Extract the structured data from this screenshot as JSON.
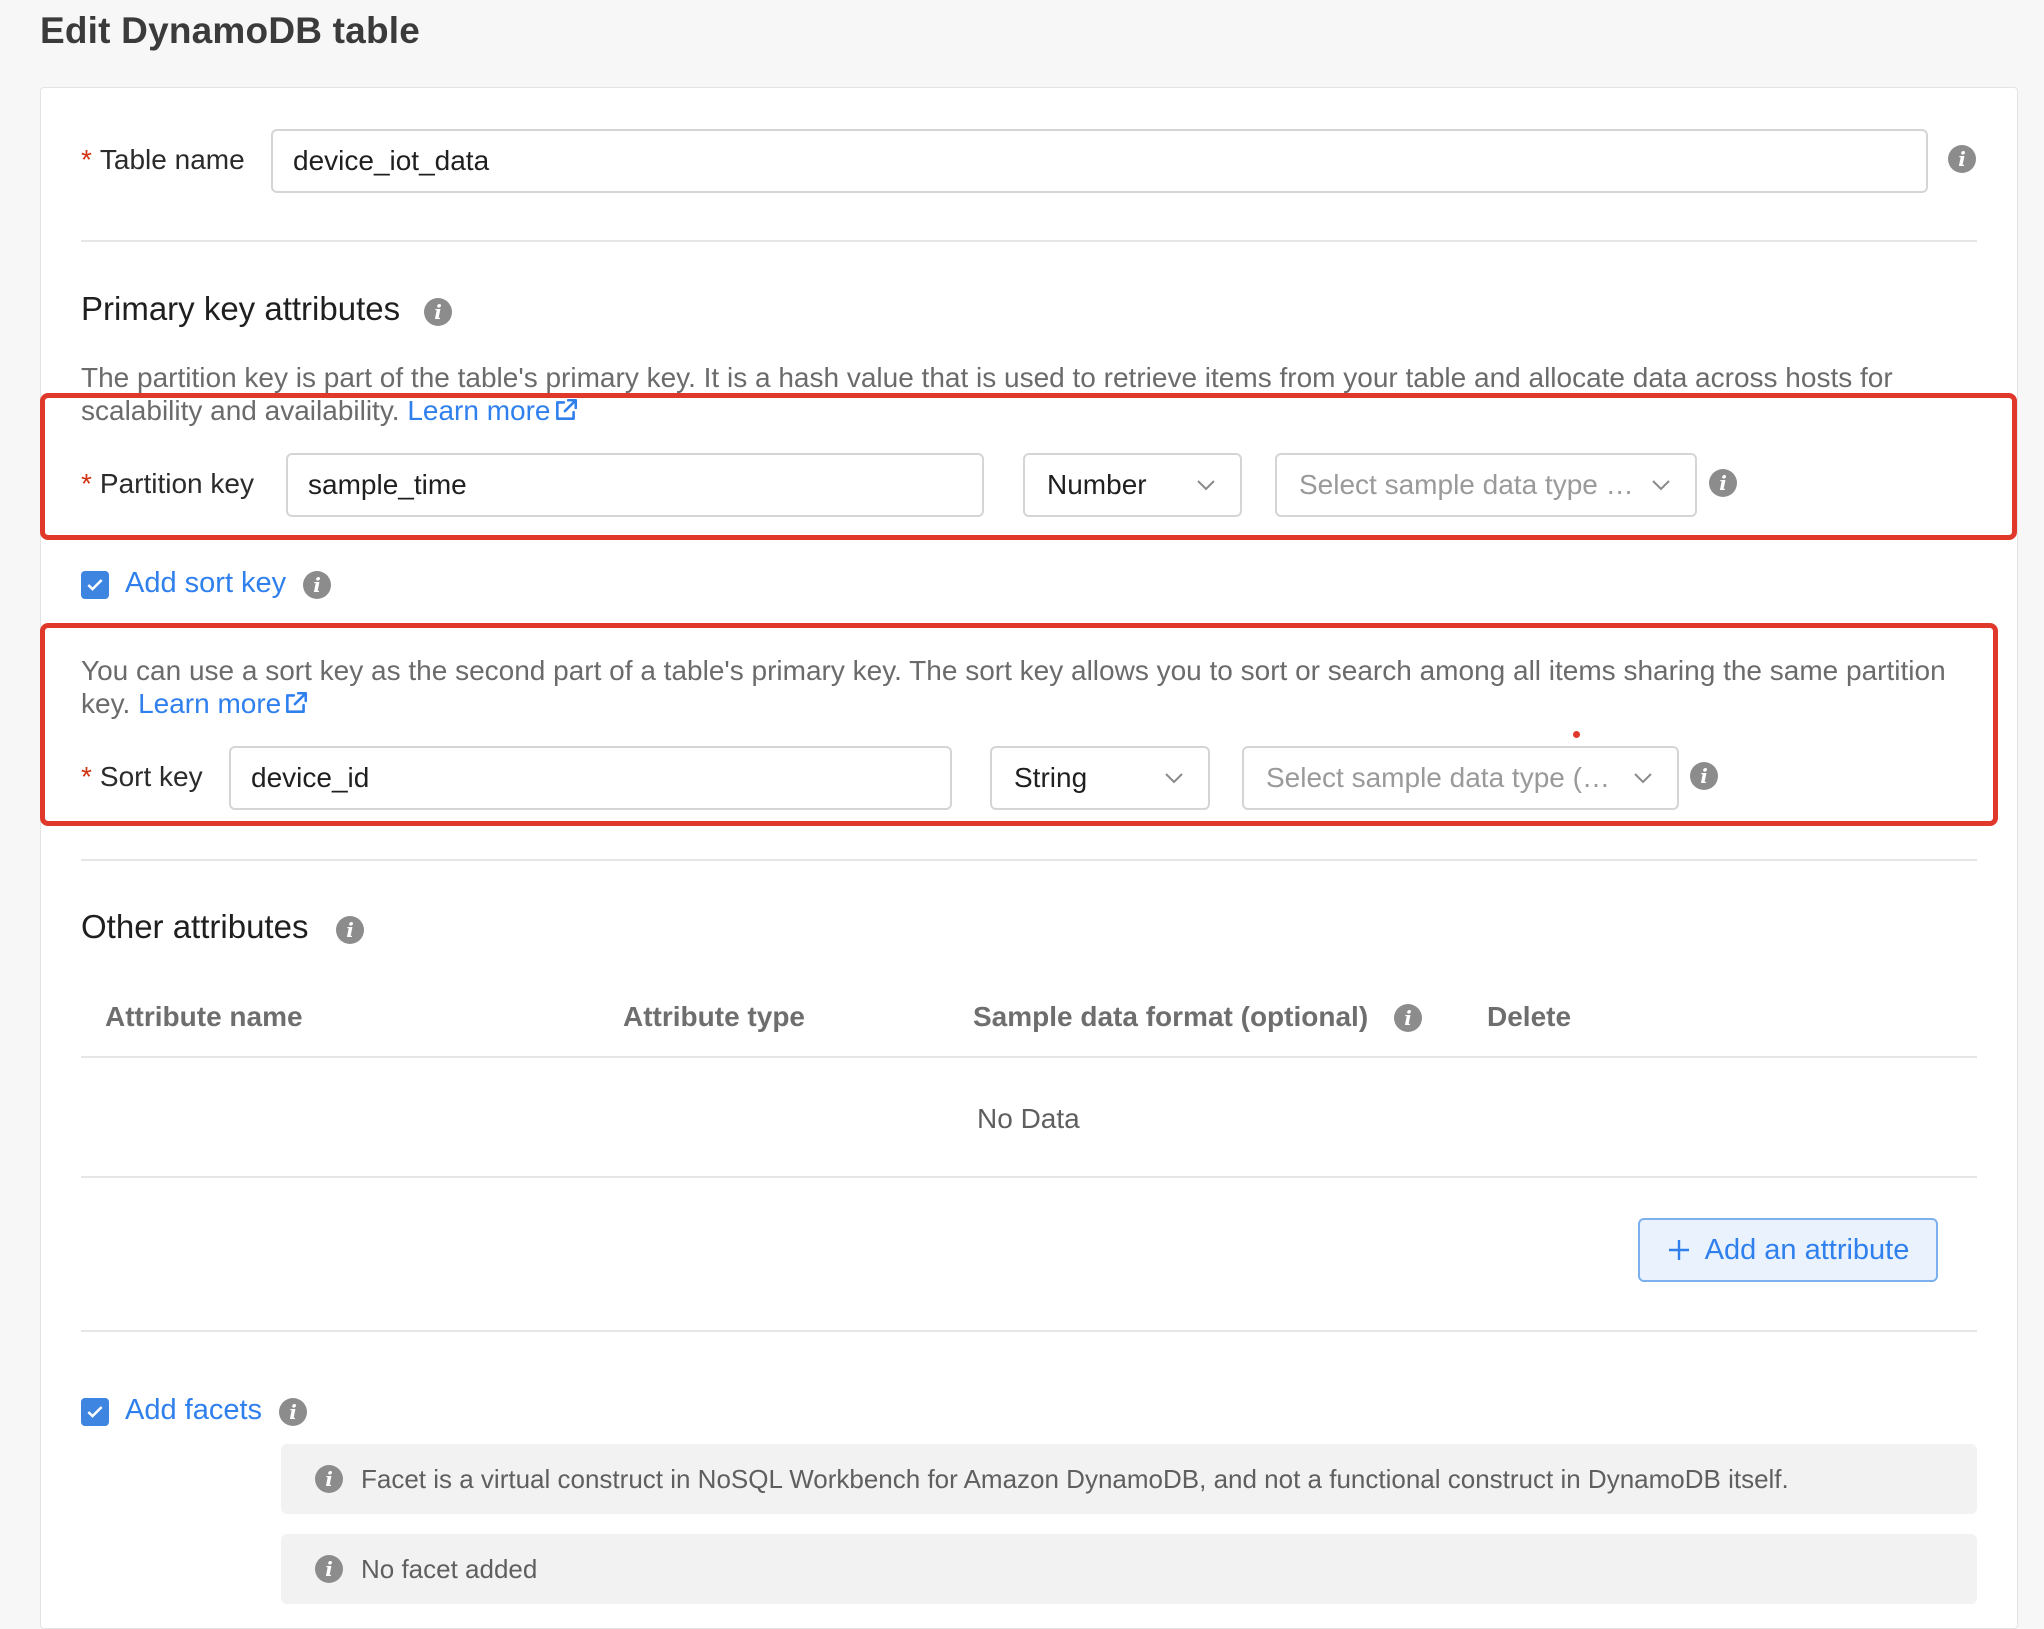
{
  "page": {
    "title": "Edit DynamoDB table"
  },
  "table_name": {
    "label": "Table name",
    "value": "device_iot_data"
  },
  "primary_key": {
    "title": "Primary key attributes",
    "description": "The partition key is part of the table's primary key. It is a hash value that is used to retrieve items from your table and allocate data across hosts for scalability and availability.",
    "learn_more": "Learn more",
    "partition_key": {
      "label": "Partition key",
      "value": "sample_time",
      "type": "Number",
      "sample_placeholder": "Select sample data type …"
    }
  },
  "sort_key": {
    "checkbox_label": "Add sort key",
    "checked": true,
    "description": "You can use a sort key as the second part of a table's primary key. The sort key allows you to sort or search among all items sharing the same partition key.",
    "learn_more": "Learn more",
    "label": "Sort key",
    "value": "device_id",
    "type": "String",
    "sample_placeholder": "Select sample data type (…"
  },
  "other_attributes": {
    "title": "Other attributes",
    "columns": [
      "Attribute name",
      "Attribute type",
      "Sample data format (optional)",
      "Delete"
    ],
    "empty_text": "No Data",
    "add_button": "Add an attribute"
  },
  "facets": {
    "checkbox_label": "Add facets",
    "checked": true,
    "info_text": "Facet is a virtual construct in NoSQL Workbench for Amazon DynamoDB, and not a functional construct in DynamoDB itself.",
    "empty_text": "No facet added"
  },
  "colors": {
    "accent": "#2f80ed",
    "required": "#d13212",
    "highlight_box": "#e0392b"
  }
}
